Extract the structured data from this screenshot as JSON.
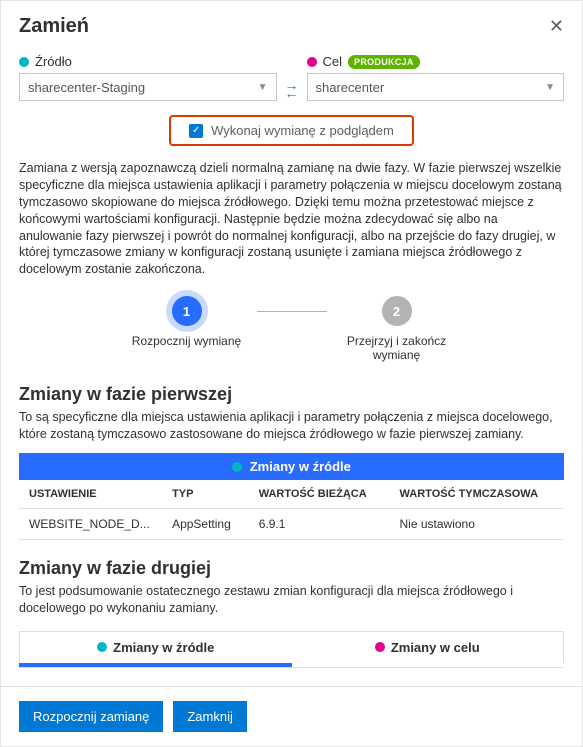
{
  "header": {
    "title": "Zamień"
  },
  "source": {
    "label": "Źródło",
    "value": "sharecenter-Staging"
  },
  "target": {
    "label": "Cel",
    "badge": "PRODUKCJA",
    "value": "sharecenter"
  },
  "preview": {
    "label": "Wykonaj wymianę z podglądem"
  },
  "description": "Zamiana z wersją zapoznawczą dzieli normalną zamianę na dwie fazy. W fazie pierwszej wszelkie specyficzne dla miejsca ustawienia aplikacji i parametry połączenia w miejscu docelowym zostaną tymczasowo skopiowane do miejsca źródłowego. Dzięki temu można przetestować miejsce z końcowymi wartościami konfiguracji. Następnie będzie można zdecydować się albo na anulowanie fazy pierwszej i powrót do normalnej konfiguracji, albo na przejście do fazy drugiej, w której tymczasowe zmiany w konfiguracji zostaną usunięte i zamiana miejsca źródłowego z docelowym zostanie zakończona.",
  "steps": {
    "s1_num": "1",
    "s1_label": "Rozpocznij wymianę",
    "s2_num": "2",
    "s2_label": "Przejrzyj i zakończ wymianę"
  },
  "phase1": {
    "heading": "Zmiany w fazie pierwszej",
    "desc": "To są specyficzne dla miejsca ustawienia aplikacji i parametry połączenia z miejsca docelowego, które zostaną tymczasowo zastosowane do miejsca źródłowego w fazie pierwszej zamiany.",
    "tabLabel": "Zmiany w źródle",
    "columns": {
      "setting": "USTAWIENIE",
      "type": "TYP",
      "current": "WARTOŚĆ BIEŻĄCA",
      "temp": "WARTOŚĆ TYMCZASOWA"
    },
    "rows": [
      {
        "setting": "WEBSITE_NODE_D...",
        "type": "AppSetting",
        "current": "6.9.1",
        "temp": "Nie ustawiono"
      }
    ]
  },
  "phase2": {
    "heading": "Zmiany w fazie drugiej",
    "desc": "To jest podsumowanie ostatecznego zestawu zmian konfiguracji dla miejsca źródłowego i docelowego po wykonaniu zamiany.",
    "tabSource": "Zmiany w źródle",
    "tabTarget": "Zmiany w celu"
  },
  "footer": {
    "start": "Rozpocznij zamianę",
    "close": "Zamknij"
  }
}
